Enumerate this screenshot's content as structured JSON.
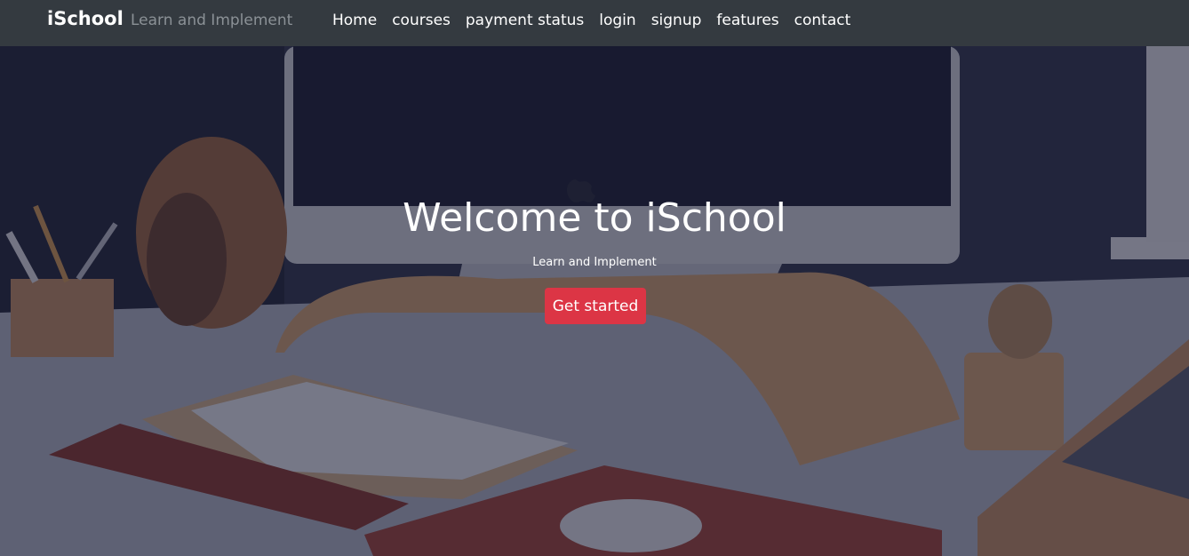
{
  "navbar": {
    "brand": "iSchool",
    "tagline": "Learn and Implement",
    "links": [
      "Home",
      "courses",
      "payment status",
      "login",
      "signup",
      "features",
      "contact"
    ]
  },
  "hero": {
    "title": "Welcome to iSchool",
    "subtitle": "Learn and Implement",
    "cta_label": "Get started"
  },
  "colors": {
    "navbar_bg": "#343a40",
    "cta_bg": "#dc3545",
    "tagline": "#8b9196"
  }
}
